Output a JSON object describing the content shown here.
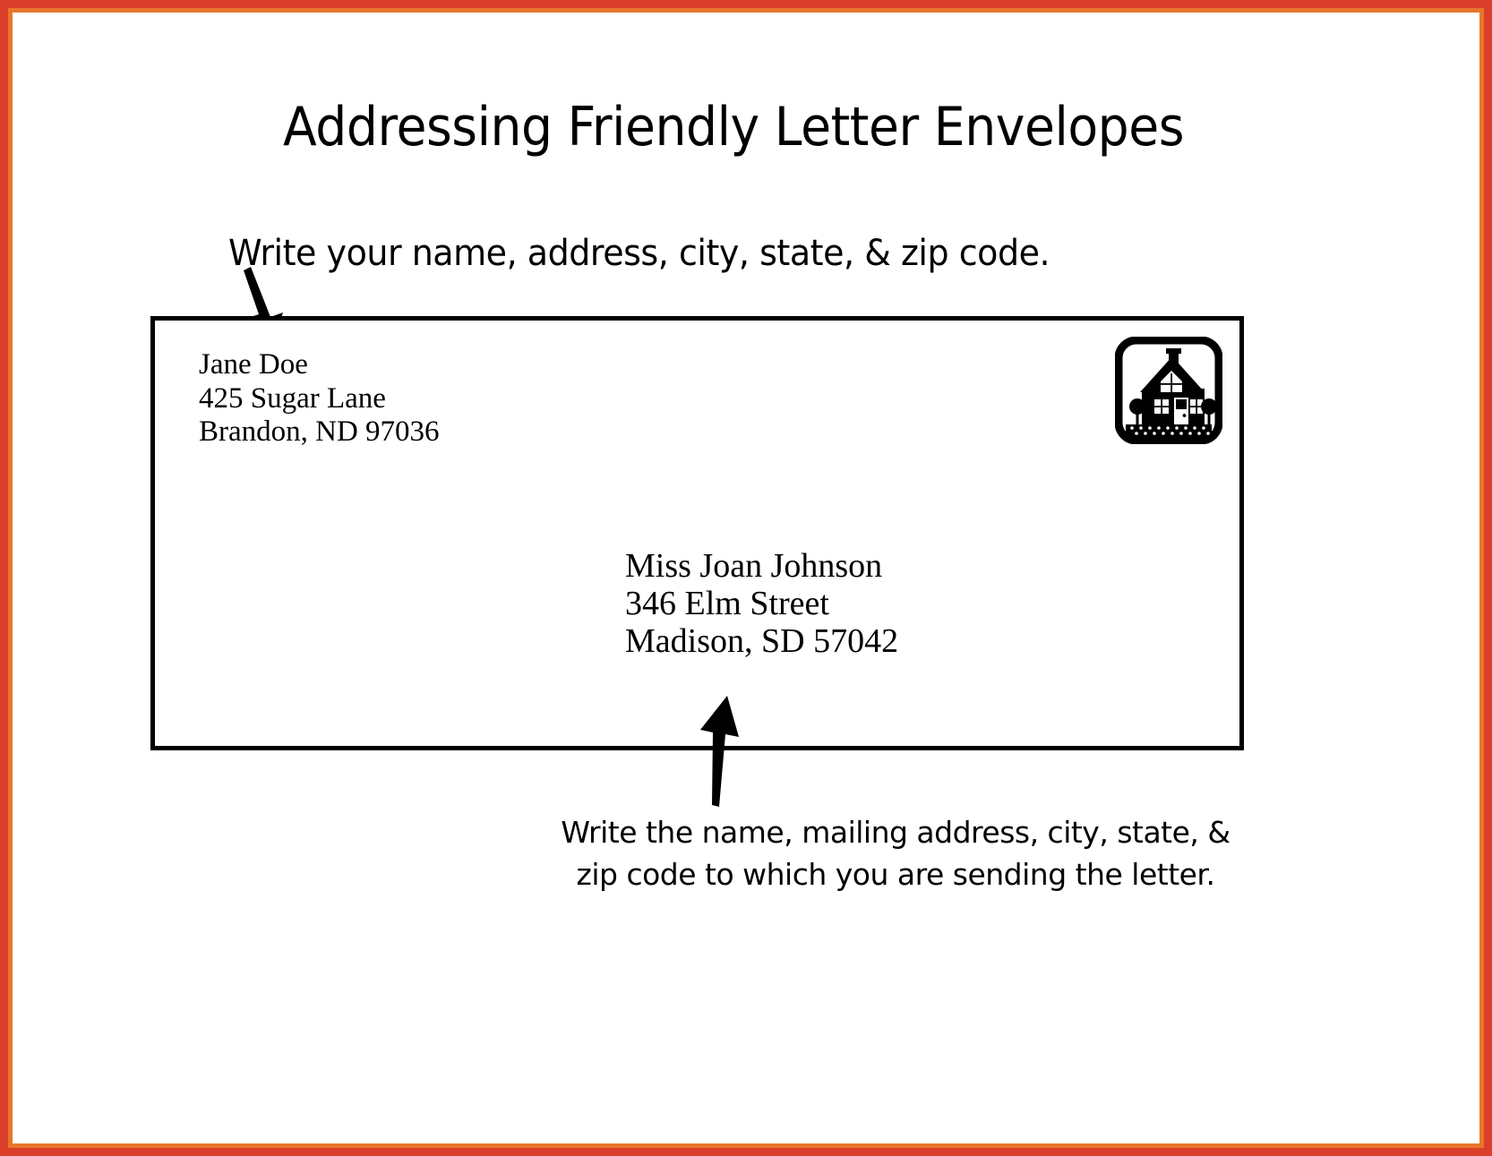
{
  "page": {
    "title": "Addressing Friendly Letter Envelopes",
    "border_outer_color": "#d93f2b",
    "border_inner_color": "#e8762b",
    "background_color": "#ffffff",
    "ink_color": "#000000"
  },
  "instructions": {
    "top": "Write your name, address, city, state, & zip code.",
    "bottom_line1": "Write the name, mailing address, city, state, &",
    "bottom_line2": "zip code to which you are sending the letter."
  },
  "envelope": {
    "return_address": {
      "name": "Jane Doe",
      "street": "425 Sugar Lane",
      "city_state_zip": "Brandon, ND  97036"
    },
    "recipient_address": {
      "name": "Miss Joan Johnson",
      "street": "346 Elm Street",
      "city_state_zip": "Madison, SD  57042"
    },
    "stamp": {
      "icon": "house-stamp-icon"
    }
  },
  "annotations": {
    "arrow_to_return_address": "arrow-down-icon",
    "arrow_to_recipient_address": "arrow-up-icon"
  }
}
